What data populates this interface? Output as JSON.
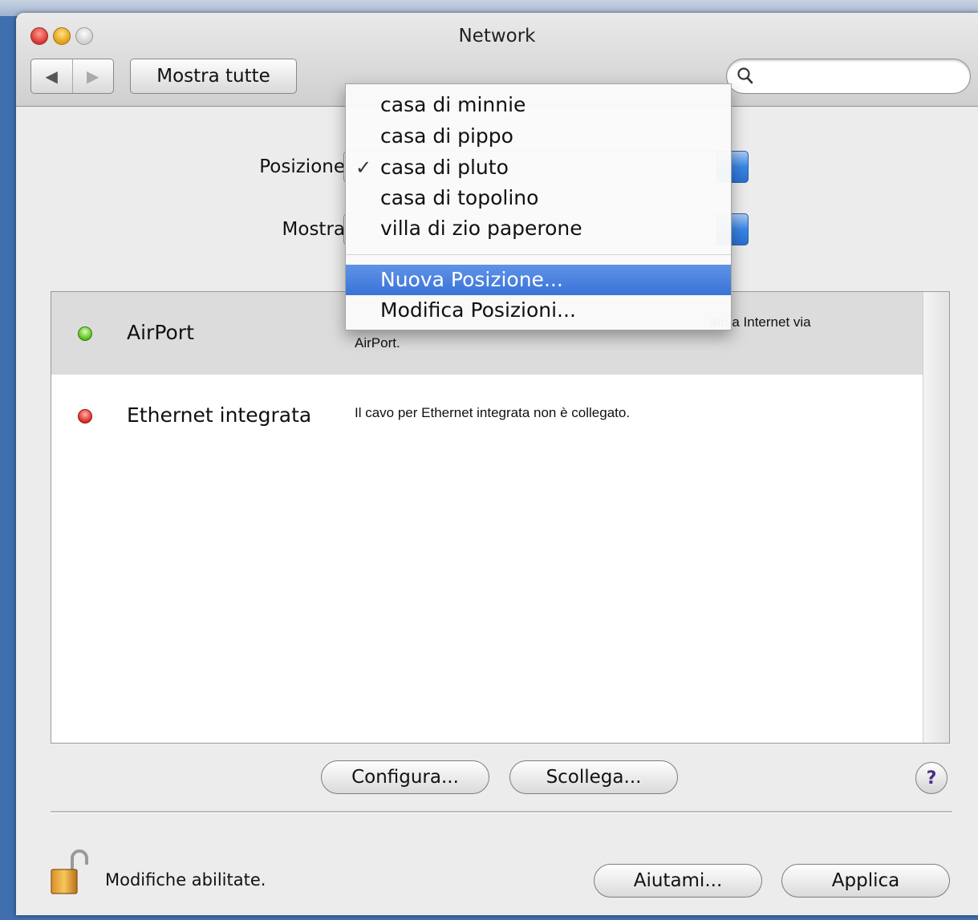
{
  "window": {
    "title": "Network"
  },
  "toolbar": {
    "back_glyph": "◀",
    "forward_glyph": "▶",
    "show_all_label": "Mostra tutte",
    "search_placeholder": ""
  },
  "form": {
    "position_label": "Posizione",
    "show_label": "Mostra"
  },
  "location_menu": {
    "items": [
      {
        "label": "casa di minnie",
        "checked": false
      },
      {
        "label": "casa di pippo",
        "checked": false
      },
      {
        "label": "casa di pluto",
        "checked": true
      },
      {
        "label": "casa di topolino",
        "checked": false
      },
      {
        "label": "villa di zio paperone",
        "checked": false
      }
    ],
    "check_glyph": "✓",
    "actions": [
      {
        "label": "Nuova Posizione...",
        "highlighted": true
      },
      {
        "label": "Modifica Posizioni...",
        "highlighted": false
      }
    ]
  },
  "services": [
    {
      "name": "AirPort",
      "status_color": "green",
      "desc_line1": "ato a Internet via",
      "desc_line2": "AirPort."
    },
    {
      "name": "Ethernet integrata",
      "status_color": "red",
      "desc_line1": "Il cavo per Ethernet integrata non è collegato.",
      "desc_line2": ""
    }
  ],
  "buttons": {
    "configure": "Configura...",
    "disconnect": "Scollega...",
    "help": "?",
    "assist": "Aiutami...",
    "apply": "Applica"
  },
  "lock": {
    "text": "Modifiche abilitate."
  },
  "colors": {
    "menu_highlight": "#3a73d8",
    "desktop": "#3f6fae"
  }
}
